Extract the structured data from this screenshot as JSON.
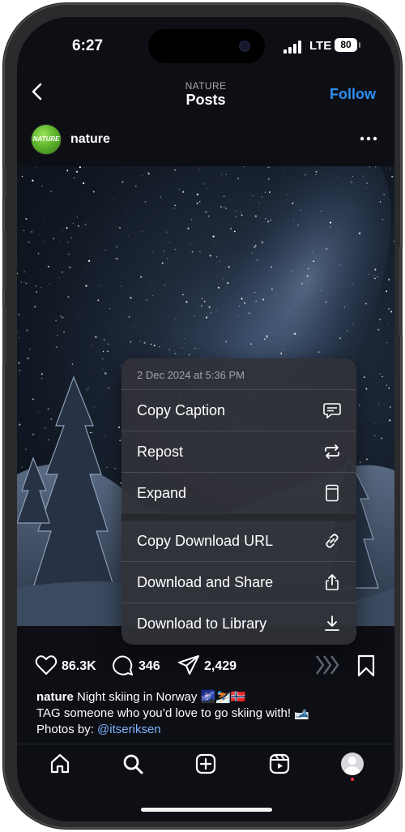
{
  "status_bar": {
    "time": "6:27",
    "network": "LTE",
    "battery": "80"
  },
  "nav": {
    "subtitle": "NATURE",
    "title": "Posts",
    "follow_label": "Follow"
  },
  "post": {
    "avatar_text": "NATURE",
    "username": "nature",
    "likes": "86.3K",
    "comments": "346",
    "shares": "2,429",
    "caption_user": "nature",
    "caption_line1": "Night skiing in Norway 🌌⛷️🇳🇴",
    "caption_line2": "TAG someone who you’d love to go skiing with! 🎿",
    "caption_line3_prefix": "Photos by: ",
    "caption_mention": "@itseriksen"
  },
  "context_menu": {
    "date": "2 Dec 2024 at 5:36 PM",
    "items": [
      {
        "label": "Copy Caption",
        "icon": "caption-bubble-icon"
      },
      {
        "label": "Repost",
        "icon": "repost-arrows-icon"
      },
      {
        "label": "Expand",
        "icon": "expand-phone-icon"
      },
      {
        "label": "Copy Download URL",
        "icon": "link-icon"
      },
      {
        "label": "Download and Share",
        "icon": "share-icon"
      },
      {
        "label": "Download to Library",
        "icon": "download-icon"
      }
    ]
  },
  "colors": {
    "accent": "#2d8ff5",
    "background": "#0d0f14",
    "menu": "#303238"
  }
}
